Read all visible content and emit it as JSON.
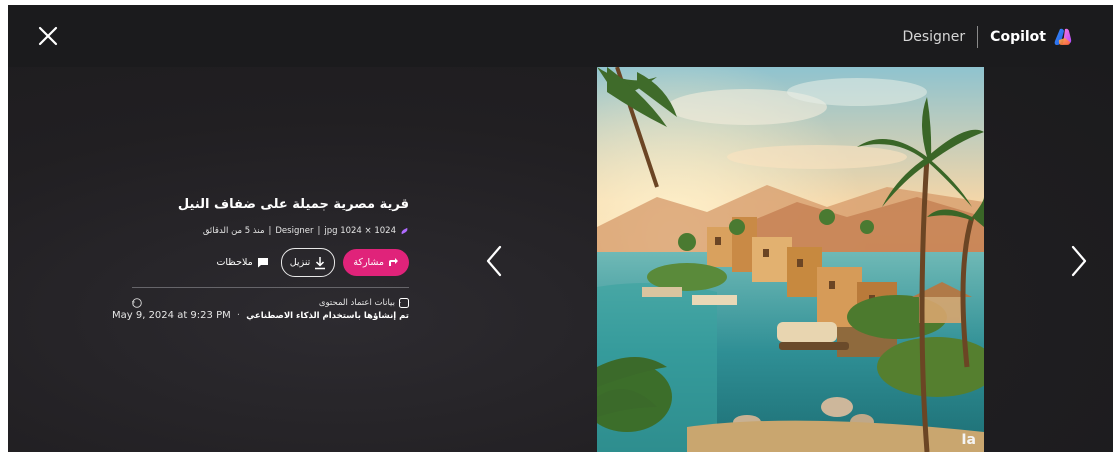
{
  "header": {
    "designer_label": "Designer",
    "copilot_label": "Copilot",
    "close_icon": "close-icon",
    "copilot_logo": "copilot-logo-icon"
  },
  "image": {
    "watermark": "Ia"
  },
  "navigation": {
    "prev_icon": "chevron-left-icon",
    "next_icon": "chevron-right-icon"
  },
  "info": {
    "title": "قرية مصرية جميلة على ضفاف النيل",
    "meta_format": "jpg 1024 × 1024",
    "meta_sep1": "|",
    "meta_source": "Designer",
    "meta_sep2": "|",
    "meta_time": "منذ 5 من الدقائق",
    "share_label": "مشاركة",
    "download_label": "تنزيل",
    "notes_label": "ملاحظات",
    "credential_label": "بيانات اعتماد المحتوى",
    "created_label": "تم إنشاؤها باستخدام الذكاء الاصطناعي",
    "created_sep": "·",
    "date": "May 9, 2024 at 9:23 PM"
  },
  "colors": {
    "accent": "#e0237a",
    "background": "#211f22"
  }
}
